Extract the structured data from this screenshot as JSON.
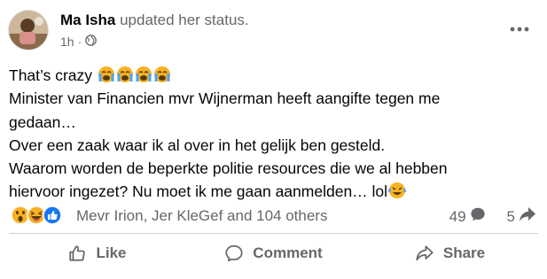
{
  "post": {
    "author": "Ma Isha",
    "action": "updated her status.",
    "time": "1h",
    "separator": "·",
    "audience_icon": "globe-icon",
    "more_icon": "more-options-icon",
    "lines": [
      "That’s crazy",
      "Minister van Financien mvr Wijnerman heeft aangifte tegen me",
      "gedaan…",
      "Over een zaak waar ik al over in het gelijk ben gesteld.",
      "Waarom worden de beperkte politie resources die we al hebben",
      "hiervoor ingezet?  Nu moet ik me gaan aanmelden… lol"
    ]
  },
  "reactions": {
    "icons": [
      "wow-reaction-icon",
      "haha-reaction-icon",
      "like-reaction-icon"
    ],
    "names": "Mevr Irion, Jer KleGef and 104 others",
    "comments_count": "49",
    "shares_count": "5"
  },
  "actions": {
    "like": "Like",
    "comment": "Comment",
    "share": "Share"
  },
  "colors": {
    "text": "#050505",
    "secondary": "#65676b",
    "like_blue": "#1877f2",
    "reaction_yellow": "#f7b125",
    "divider": "#ced0d4"
  }
}
